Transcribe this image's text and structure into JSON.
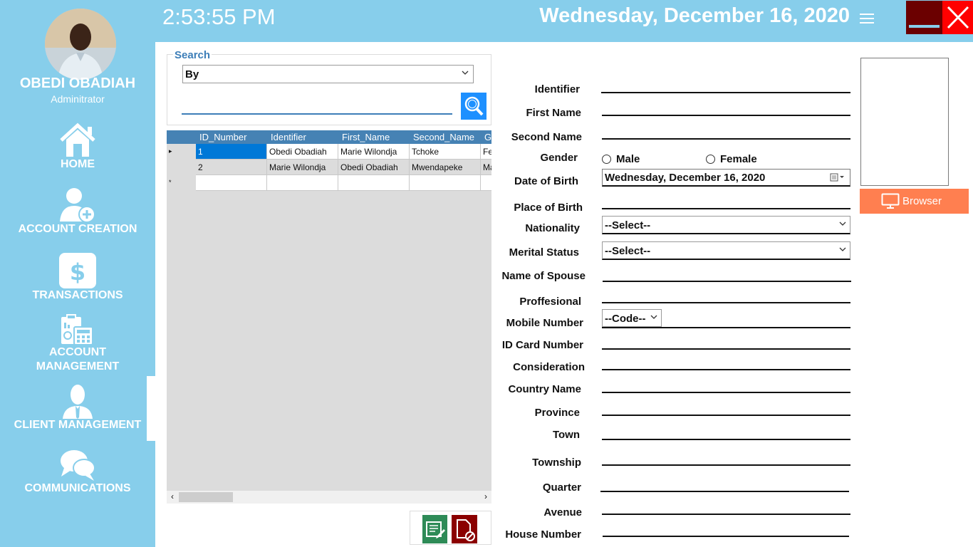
{
  "user": {
    "name": "OBEDI OBADIAH",
    "role": "Adminitrator"
  },
  "nav": {
    "home": "HOME",
    "account_creation": "ACCOUNT CREATION",
    "transactions": "TRANSACTIONS",
    "account_management_1": "ACCOUNT",
    "account_management_2": "MANAGEMENT",
    "client_management": "CLIENT MANAGEMENT",
    "communications": "COMMUNICATIONS"
  },
  "header": {
    "time": "2:53:55 PM",
    "date": "Wednesday, December 16, 2020"
  },
  "search": {
    "legend": "Search",
    "by": "By",
    "value": ""
  },
  "grid": {
    "columns": [
      "ID_Number",
      "Identifier",
      "First_Name",
      "Second_Name",
      "G"
    ],
    "rows": [
      [
        "1",
        "Obedi Obadiah",
        "Marie Wilondja",
        "Tchoke",
        "Fe"
      ],
      [
        "2",
        "Marie Wilondja",
        "Obedi Obadiah",
        "Mwendapeke",
        "Ma"
      ]
    ],
    "new_row_marker": "*",
    "current_row_marker": "▸"
  },
  "form": {
    "labels": {
      "identifier": "Identifier",
      "first_name": "First Name",
      "second_name": "Second Name",
      "gender": "Gender",
      "dob": "Date of Birth",
      "pob": "Place of Birth",
      "nationality": "Nationality",
      "marital": "Merital Status",
      "spouse": "Name of Spouse",
      "profession": "Proffesional",
      "mobile": "Mobile Number",
      "id_card": "ID Card Number",
      "consideration": "Consideration",
      "country": "Country Name",
      "province": "Province",
      "town": "Town",
      "township": "Township",
      "quarter": "Quarter",
      "avenue": "Avenue",
      "house": "House Number"
    },
    "gender_male": "Male",
    "gender_female": "Female",
    "dob_value": "Wednesday,  December  16, 2020",
    "nationality_value": "--Select--",
    "marital_value": "--Select--",
    "mobile_code": "--Code--"
  },
  "photo": {
    "browse_label": "Browser"
  },
  "colors": {
    "sidebar": "#87ceeb",
    "grid_header": "#4682b4",
    "selected_cell": "#0078d7",
    "browse_button": "#ff7f50",
    "edit_button": "#2e8b57",
    "delete_button": "#8b0000",
    "close_button": "#ff0000",
    "minimize_button": "#6b0000"
  }
}
